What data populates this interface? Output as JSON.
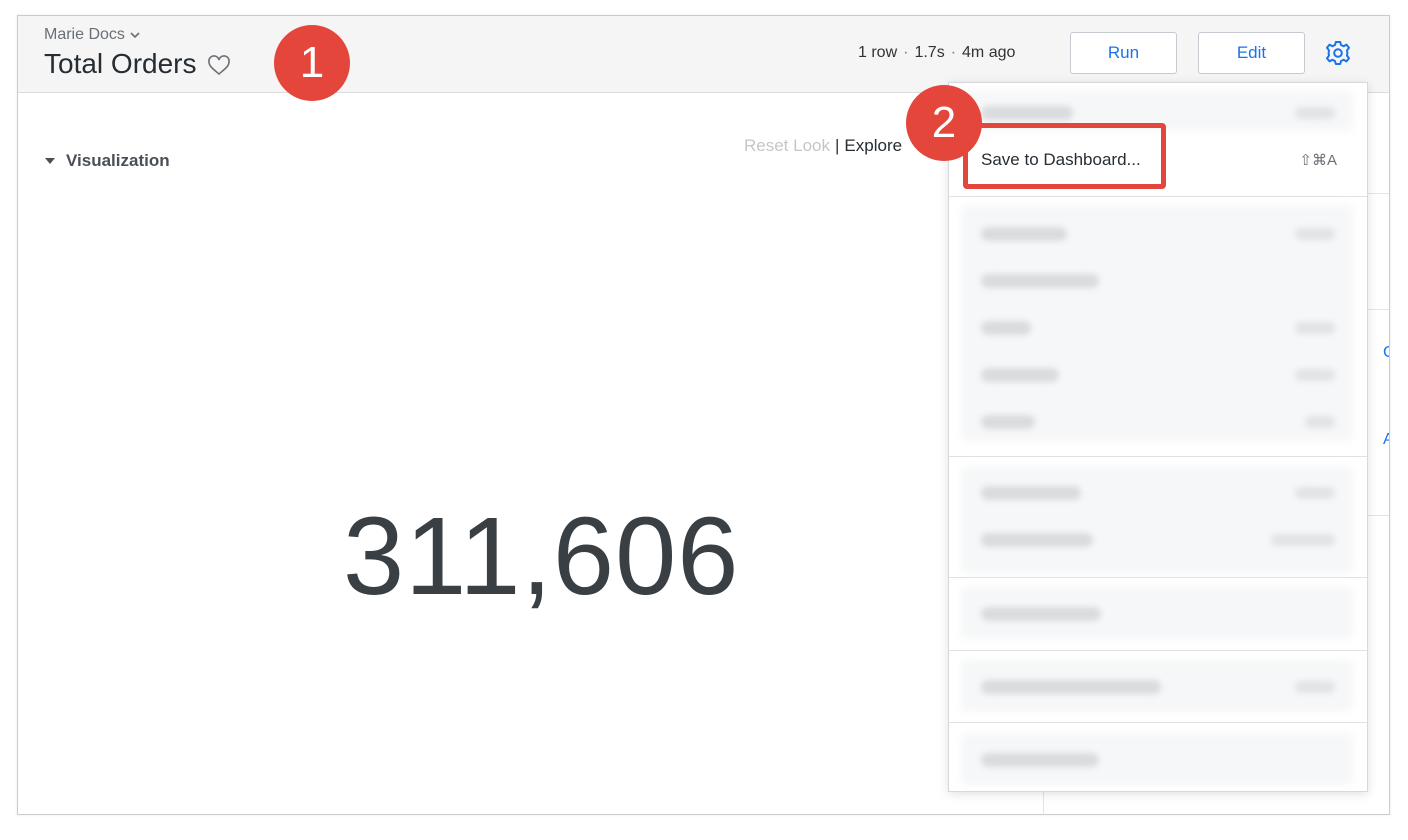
{
  "header": {
    "folder_label": "Marie Docs",
    "title": "Total Orders",
    "meta": {
      "rows": "1 row",
      "duration": "1.7s",
      "age": "4m ago",
      "separator": "·"
    },
    "run_label": "Run",
    "edit_label": "Edit"
  },
  "visualization": {
    "toggle_label": "Visualization",
    "reset_look_label": "Reset Look",
    "divider": "|",
    "explore_label": "Explore",
    "value": "311,606"
  },
  "right_panel": {
    "peek_1": "C",
    "peek_2": "Ad"
  },
  "menu": {
    "save_to_dashboard": {
      "label": "Save to Dashboard...",
      "shortcut": "⇧⌘A"
    }
  },
  "annotations": {
    "badge_1": "1",
    "badge_2": "2"
  },
  "colors": {
    "accent": "#1a73e8",
    "callout": "#e5463b",
    "header_bg": "#f5f5f5"
  },
  "icons": {
    "folder_chevron": "chevron-down-icon",
    "favorite": "heart-icon",
    "settings": "gear-icon",
    "collapse": "caret-down-icon"
  }
}
